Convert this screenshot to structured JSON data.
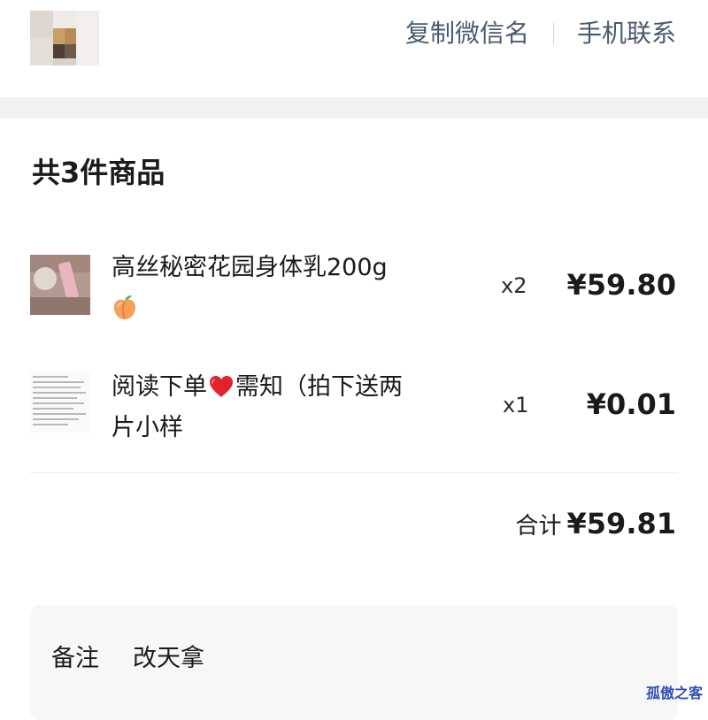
{
  "header": {
    "copy_wechat_name": "复制微信名",
    "contact_phone": "手机联系"
  },
  "items_section": {
    "title": "共3件商品",
    "items": [
      {
        "name": "高丝秘密花园身体乳200g",
        "emoji": "peach-icon",
        "quantity": "x2",
        "price": "¥59.80"
      },
      {
        "name_before": "阅读下单",
        "emoji": "heart-icon",
        "name_after": "需知（拍下送两片小样",
        "quantity": "x1",
        "price": "¥0.01"
      }
    ]
  },
  "summary": {
    "total_label": "合计",
    "total_value": "¥59.81"
  },
  "note": {
    "label": "备注",
    "text": "改天拿"
  },
  "watermark": "孤傲之客",
  "colors": {
    "header_link": "#4a5a6e",
    "watermark": "#2f4fb8",
    "heart": "#e0242d",
    "note_bg": "#f7f7f7"
  }
}
